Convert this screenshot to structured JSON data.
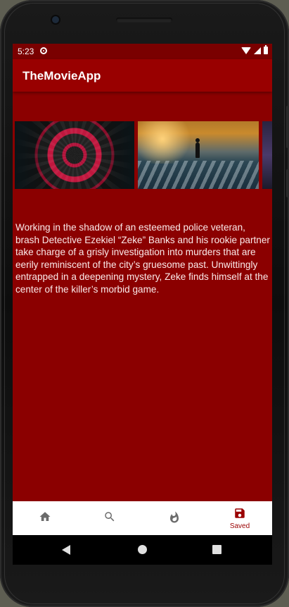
{
  "status_bar": {
    "time": "5:23"
  },
  "app_bar": {
    "title": "TheMovieApp"
  },
  "posters": [
    {
      "name": "poster-1"
    },
    {
      "name": "poster-2"
    },
    {
      "name": "poster-3"
    }
  ],
  "overview": "Working in the shadow of an esteemed police veteran, brash Detective Ezekiel “Zeke” Banks and his rookie partner take charge of a grisly investigation into murders that are eerily reminiscent of the city’s gruesome past.  Unwittingly entrapped in a deepening mystery, Zeke finds himself at the center of the killer’s morbid game.",
  "bottom_nav": {
    "items": [
      {
        "icon": "home-icon",
        "label": ""
      },
      {
        "icon": "search-icon",
        "label": ""
      },
      {
        "icon": "fire-icon",
        "label": ""
      },
      {
        "icon": "save-icon",
        "label": "Saved"
      }
    ],
    "active_index": 3
  },
  "colors": {
    "screen_bg": "#8b0000",
    "app_bar": "#990000",
    "status_bar": "#7a0000",
    "accent": "#9a0000",
    "icon_inactive": "#6b6b6b"
  }
}
